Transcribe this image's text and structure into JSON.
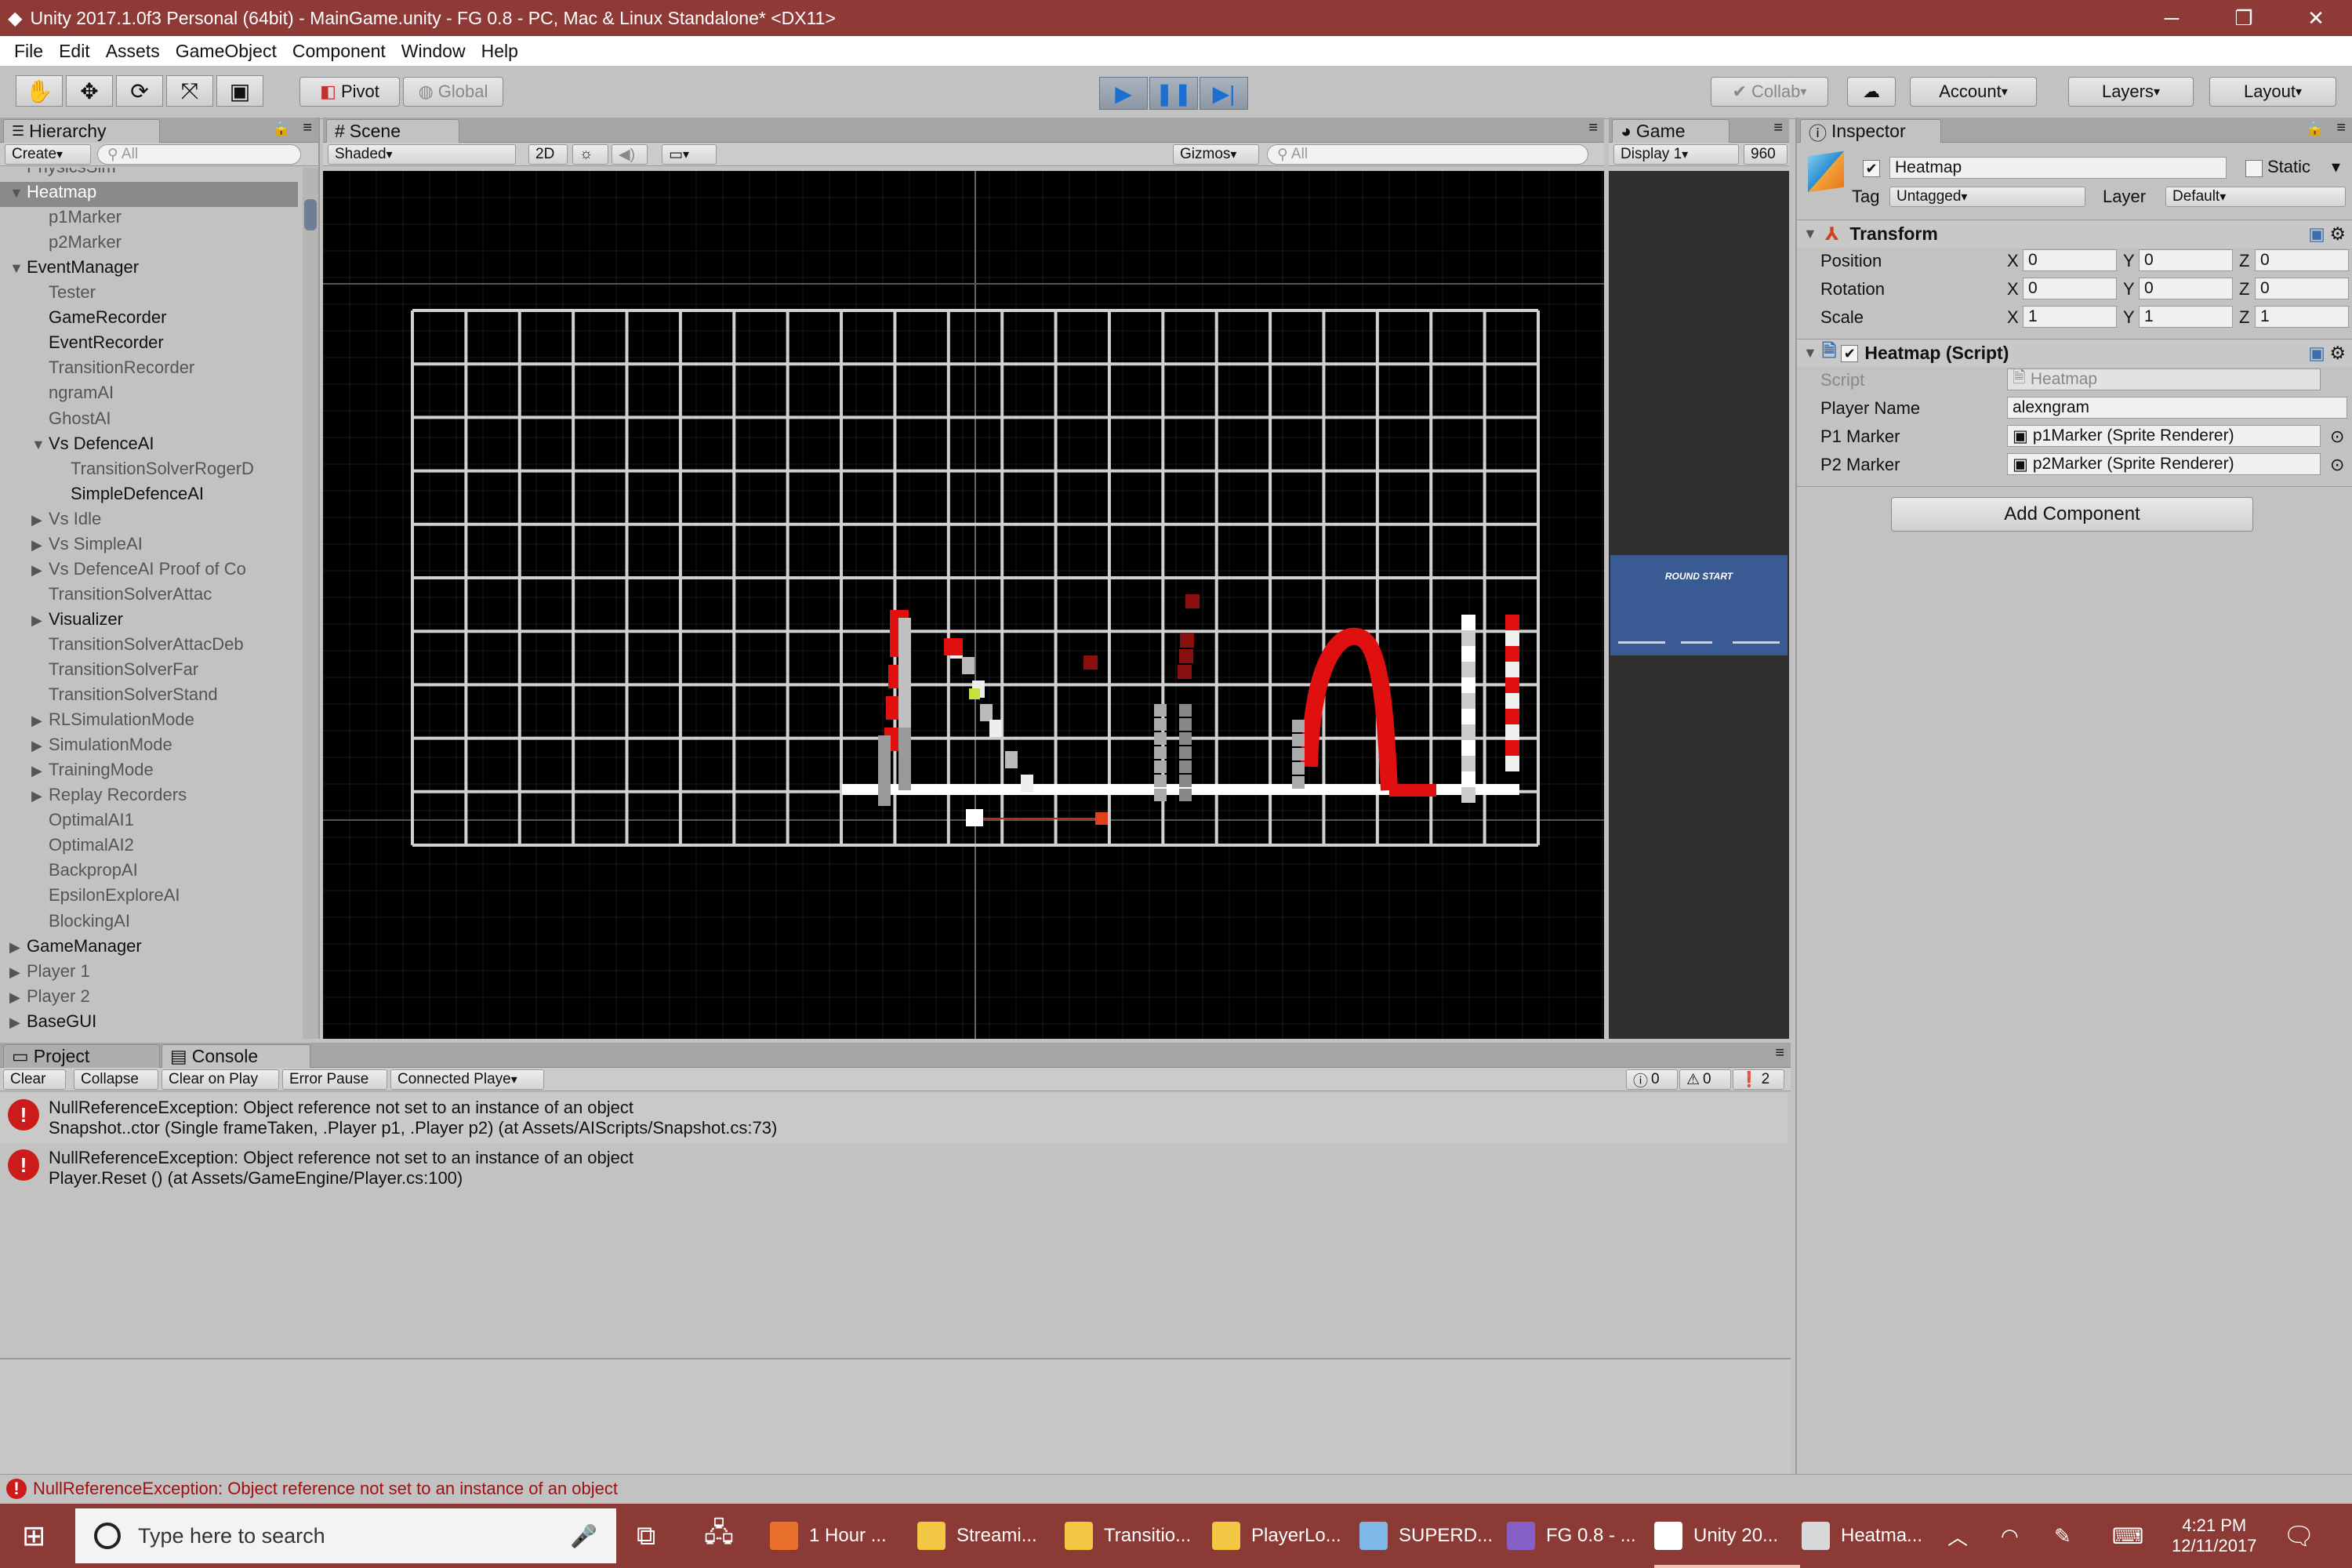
{
  "window": {
    "title": "Unity 2017.1.0f3 Personal (64bit) - MainGame.unity - FG 0.8 - PC, Mac & Linux Standalone* <DX11>",
    "controls": [
      "─",
      "❐",
      "✕"
    ]
  },
  "menu": [
    "File",
    "Edit",
    "Assets",
    "GameObject",
    "Component",
    "Window",
    "Help"
  ],
  "toolbar": {
    "pivot": "Pivot",
    "global": "Global",
    "collab": "Collab",
    "account": "Account",
    "layers": "Layers",
    "layout": "Layout"
  },
  "hierarchy": {
    "tab": "Hierarchy",
    "create": "Create",
    "search_placeholder": "All",
    "items": [
      {
        "label": "PhysicsSim",
        "depth": 1,
        "arrow": "",
        "style": "grey"
      },
      {
        "label": "Heatmap",
        "depth": 1,
        "arrow": "▼",
        "style": "selected"
      },
      {
        "label": "p1Marker",
        "depth": 2,
        "arrow": "",
        "style": "grey"
      },
      {
        "label": "p2Marker",
        "depth": 2,
        "arrow": "",
        "style": "grey"
      },
      {
        "label": "EventManager",
        "depth": 1,
        "arrow": "▼",
        "style": ""
      },
      {
        "label": "Tester",
        "depth": 2,
        "arrow": "",
        "style": "grey"
      },
      {
        "label": "GameRecorder",
        "depth": 2,
        "arrow": "",
        "style": ""
      },
      {
        "label": "EventRecorder",
        "depth": 2,
        "arrow": "",
        "style": ""
      },
      {
        "label": "TransitionRecorder",
        "depth": 2,
        "arrow": "",
        "style": "grey"
      },
      {
        "label": "ngramAI",
        "depth": 2,
        "arrow": "",
        "style": "grey"
      },
      {
        "label": "GhostAI",
        "depth": 2,
        "arrow": "",
        "style": "grey"
      },
      {
        "label": "Vs DefenceAI",
        "depth": 2,
        "arrow": "▼",
        "style": ""
      },
      {
        "label": "TransitionSolverRogerD",
        "depth": 3,
        "arrow": "",
        "style": "grey"
      },
      {
        "label": "SimpleDefenceAI",
        "depth": 3,
        "arrow": "",
        "style": ""
      },
      {
        "label": "Vs Idle",
        "depth": 2,
        "arrow": "▶",
        "style": "grey"
      },
      {
        "label": "Vs SimpleAI",
        "depth": 2,
        "arrow": "▶",
        "style": "grey"
      },
      {
        "label": "Vs DefenceAI Proof of Co",
        "depth": 2,
        "arrow": "▶",
        "style": "grey"
      },
      {
        "label": "TransitionSolverAttac",
        "depth": 2,
        "arrow": "",
        "style": "grey"
      },
      {
        "label": "Visualizer",
        "depth": 2,
        "arrow": "▶",
        "style": ""
      },
      {
        "label": "TransitionSolverAttacDeb",
        "depth": 2,
        "arrow": "",
        "style": "grey"
      },
      {
        "label": "TransitionSolverFar",
        "depth": 2,
        "arrow": "",
        "style": "grey"
      },
      {
        "label": "TransitionSolverStand",
        "depth": 2,
        "arrow": "",
        "style": "grey"
      },
      {
        "label": "RLSimulationMode",
        "depth": 2,
        "arrow": "▶",
        "style": "grey"
      },
      {
        "label": "SimulationMode",
        "depth": 2,
        "arrow": "▶",
        "style": "grey"
      },
      {
        "label": "TrainingMode",
        "depth": 2,
        "arrow": "▶",
        "style": "grey"
      },
      {
        "label": "Replay Recorders",
        "depth": 2,
        "arrow": "▶",
        "style": "grey"
      },
      {
        "label": "OptimalAI1",
        "depth": 2,
        "arrow": "",
        "style": "grey"
      },
      {
        "label": "OptimalAI2",
        "depth": 2,
        "arrow": "",
        "style": "grey"
      },
      {
        "label": "BackpropAI",
        "depth": 2,
        "arrow": "",
        "style": "grey"
      },
      {
        "label": "EpsilonExploreAI",
        "depth": 2,
        "arrow": "",
        "style": "grey"
      },
      {
        "label": "BlockingAI",
        "depth": 2,
        "arrow": "",
        "style": "grey"
      },
      {
        "label": "GameManager",
        "depth": 1,
        "arrow": "▶",
        "style": ""
      },
      {
        "label": "Player 1",
        "depth": 1,
        "arrow": "▶",
        "style": "grey"
      },
      {
        "label": "Player 2",
        "depth": 1,
        "arrow": "▶",
        "style": "grey"
      },
      {
        "label": "BaseGUI",
        "depth": 1,
        "arrow": "▶",
        "style": ""
      }
    ]
  },
  "scene": {
    "tab": "Scene",
    "shading": "Shaded",
    "mode_2d": "2D",
    "gizmos": "Gizmos",
    "search_placeholder": "All"
  },
  "game": {
    "tab": "Game",
    "display": "Display 1",
    "resolution": "960",
    "preview_text": "ROUND START"
  },
  "inspector": {
    "tab": "Inspector",
    "object_name": "Heatmap",
    "static_label": "Static",
    "tag_label": "Tag",
    "tag_value": "Untagged",
    "layer_label": "Layer",
    "layer_value": "Default",
    "transform": {
      "title": "Transform",
      "rows": [
        {
          "label": "Position",
          "x": "0",
          "y": "0",
          "z": "0"
        },
        {
          "label": "Rotation",
          "x": "0",
          "y": "0",
          "z": "0"
        },
        {
          "label": "Scale",
          "x": "1",
          "y": "1",
          "z": "1"
        }
      ]
    },
    "script_component": {
      "title": "Heatmap (Script)",
      "script_label": "Script",
      "script_value": "Heatmap",
      "player_name_label": "Player Name",
      "player_name_value": "alexngram",
      "p1_label": "P1 Marker",
      "p1_value": "p1Marker (Sprite Renderer)",
      "p2_label": "P2 Marker",
      "p2_value": "p2Marker (Sprite Renderer)"
    },
    "add_component": "Add Component"
  },
  "console": {
    "tab_project": "Project",
    "tab_console": "Console",
    "buttons": [
      "Clear",
      "Collapse",
      "Clear on Play",
      "Error Pause",
      "Connected Playe"
    ],
    "counts": {
      "info": "0",
      "warn": "0",
      "error": "2"
    },
    "messages": [
      {
        "line1": "NullReferenceException: Object reference not set to an instance of an object",
        "line2": "Snapshot..ctor (Single frameTaken, .Player p1, .Player p2) (at Assets/AIScripts/Snapshot.cs:73)"
      },
      {
        "line1": "NullReferenceException: Object reference not set to an instance of an object",
        "line2": "Player.Reset () (at Assets/GameEngine/Player.cs:100)"
      }
    ]
  },
  "status_bar": "NullReferenceException: Object reference not set to an instance of an object",
  "taskbar": {
    "search_placeholder": "Type here to search",
    "apps": [
      {
        "label": "1 Hour ...",
        "color": "#e8702a"
      },
      {
        "label": "Streami...",
        "color": "#f2c744"
      },
      {
        "label": "Transitio...",
        "color": "#f2c744"
      },
      {
        "label": "PlayerLo...",
        "color": "#f2c744"
      },
      {
        "label": "SUPERD...",
        "color": "#7fb8e6"
      },
      {
        "label": "FG 0.8 - ...",
        "color": "#8661c5"
      },
      {
        "label": "Unity 20...",
        "color": "#ffffff"
      },
      {
        "label": "Heatma...",
        "color": "#d8d8d8"
      }
    ],
    "time": "4:21 PM",
    "date": "12/11/2017"
  }
}
